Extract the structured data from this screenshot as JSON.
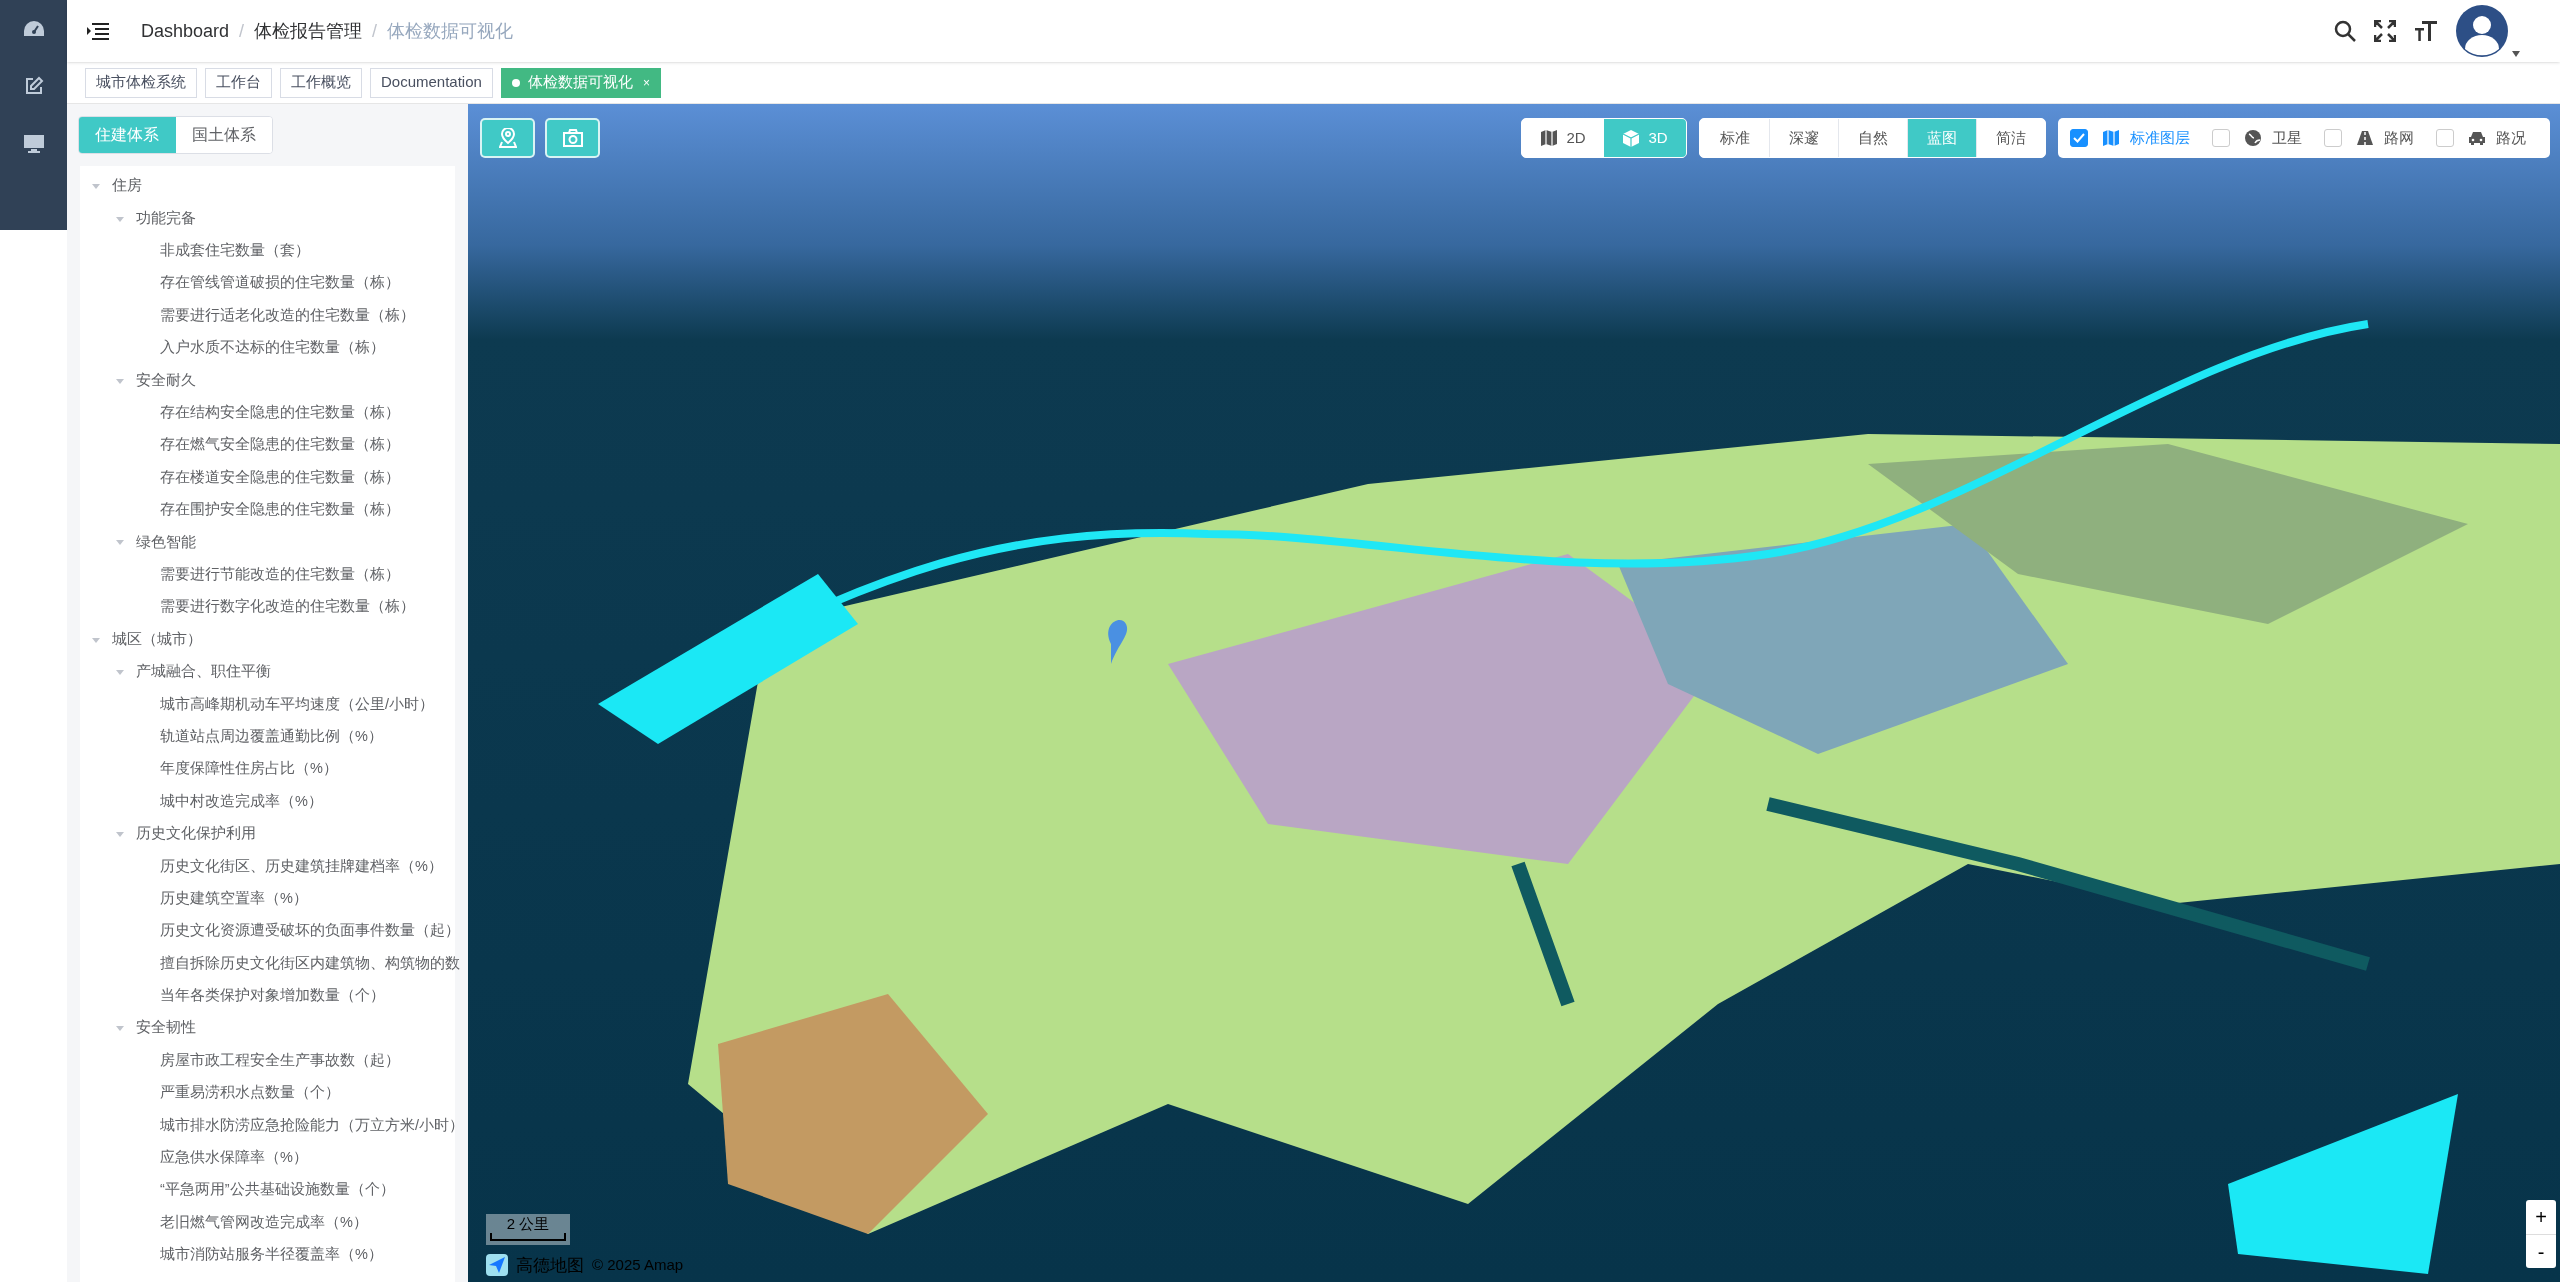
{
  "breadcrumb": [
    "Dashboard",
    "体检报告管理",
    "体检数据可视化"
  ],
  "breadcrumb_separator": "/",
  "tags": [
    {
      "label": "城市体检系统",
      "selected": false
    },
    {
      "label": "工作台",
      "selected": false
    },
    {
      "label": "工作概览",
      "selected": false
    },
    {
      "label": "Documentation",
      "selected": false
    },
    {
      "label": "体检数据可视化",
      "selected": true,
      "close": "×"
    }
  ],
  "system_tabs": [
    {
      "label": "住建体系",
      "selected": true
    },
    {
      "label": "国土体系",
      "selected": false
    }
  ],
  "tree": [
    {
      "label": "住房",
      "expanded": true,
      "children": [
        {
          "label": "功能完备",
          "expanded": true,
          "children": [
            {
              "label": "非成套住宅数量（套）"
            },
            {
              "label": "存在管线管道破损的住宅数量（栋）"
            },
            {
              "label": "需要进行适老化改造的住宅数量（栋）"
            },
            {
              "label": "入户水质不达标的住宅数量（栋）"
            }
          ]
        },
        {
          "label": "安全耐久",
          "expanded": true,
          "children": [
            {
              "label": "存在结构安全隐患的住宅数量（栋）"
            },
            {
              "label": "存在燃气安全隐患的住宅数量（栋）"
            },
            {
              "label": "存在楼道安全隐患的住宅数量（栋）"
            },
            {
              "label": "存在围护安全隐患的住宅数量（栋）"
            }
          ]
        },
        {
          "label": "绿色智能",
          "expanded": true,
          "children": [
            {
              "label": "需要进行节能改造的住宅数量（栋）"
            },
            {
              "label": "需要进行数字化改造的住宅数量（栋）"
            }
          ]
        }
      ]
    },
    {
      "label": "城区（城市）",
      "expanded": true,
      "children": [
        {
          "label": "产城融合、职住平衡",
          "expanded": true,
          "children": [
            {
              "label": "城市高峰期机动车平均速度（公里/小时）"
            },
            {
              "label": "轨道站点周边覆盖通勤比例（%）"
            },
            {
              "label": "年度保障性住房占比（%）"
            },
            {
              "label": "城中村改造完成率（%）"
            }
          ]
        },
        {
          "label": "历史文化保护利用",
          "expanded": true,
          "children": [
            {
              "label": "历史文化街区、历史建筑挂牌建档率（%）"
            },
            {
              "label": "历史建筑空置率（%）"
            },
            {
              "label": "历史文化资源遭受破坏的负面事件数量（起）"
            },
            {
              "label": "擅自拆除历史文化街区内建筑物、构筑物的数"
            },
            {
              "label": "当年各类保护对象增加数量（个）"
            }
          ]
        },
        {
          "label": "安全韧性",
          "expanded": true,
          "children": [
            {
              "label": "房屋市政工程安全生产事故数（起）"
            },
            {
              "label": "严重易涝积水点数量（个）"
            },
            {
              "label": "城市排水防涝应急抢险能力（万立方米/小时）"
            },
            {
              "label": "应急供水保障率（%）"
            },
            {
              "label": "“平急两用”公共基础设施数量（个）"
            },
            {
              "label": "老旧燃气管网改造完成率（%）"
            },
            {
              "label": "城市消防站服务半径覆盖率（%）"
            }
          ]
        }
      ]
    }
  ],
  "view_modes": [
    {
      "label": "2D",
      "kind": "map",
      "selected": false
    },
    {
      "label": "3D",
      "kind": "cube",
      "selected": true
    }
  ],
  "map_styles": [
    {
      "label": "标准",
      "selected": false
    },
    {
      "label": "深邃",
      "selected": false
    },
    {
      "label": "自然",
      "selected": false
    },
    {
      "label": "蓝图",
      "selected": true
    },
    {
      "label": "简洁",
      "selected": false
    }
  ],
  "layers": [
    {
      "label": "标准图层",
      "kind": "map",
      "checked": true
    },
    {
      "label": "卫星",
      "kind": "globe",
      "checked": false
    },
    {
      "label": "路网",
      "kind": "road",
      "checked": false
    },
    {
      "label": "路况",
      "kind": "car",
      "checked": false
    }
  ],
  "map_footer": {
    "scale": "2 公里",
    "logo": "高德地图",
    "copyright": "© 2025 Amap"
  },
  "zoom": [
    "+",
    "-"
  ]
}
